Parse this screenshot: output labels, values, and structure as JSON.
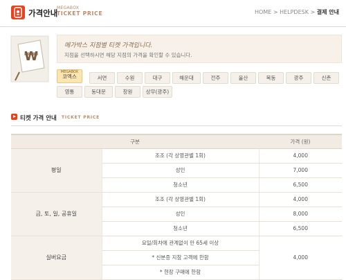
{
  "header": {
    "title": "가격안내",
    "sub_small": "MEGABOX",
    "sub_big": "TICKET PRICE",
    "breadcrumb_prefix": "HOME > HELPDESK > ",
    "breadcrumb_current": "결제 안내"
  },
  "notice": {
    "title": "메가박스 지점별 티켓 가격입니다.",
    "desc": "지점을 선택하시면 해당 지점의 가격을 확인할 수 있습니다."
  },
  "branches": {
    "row1": [
      "코엑스",
      "서면",
      "수원",
      "대구",
      "해운대",
      "전주",
      "울산",
      "목동",
      "광주",
      "신촌"
    ],
    "row2": [
      "영통",
      "동대문",
      "창원",
      "상무(광주)"
    ],
    "active_badge": "MEGABOX"
  },
  "section": {
    "title": "티켓 가격 안내",
    "title_en": "TICKET PRICE"
  },
  "table": {
    "headers": [
      "구분",
      "가격 (원)"
    ],
    "groups": [
      {
        "category": "평일",
        "rows": [
          {
            "kind": "조조 (각 상영관별 1회)",
            "price": "4,000"
          },
          {
            "kind": "성인",
            "price": "7,000"
          },
          {
            "kind": "청소년",
            "price": "6,500"
          }
        ]
      },
      {
        "category": "금, 토, 일, 공휴일",
        "rows": [
          {
            "kind": "조조 (각 상영관별 1회)",
            "price": "4,000"
          },
          {
            "kind": "성인",
            "price": "8,000"
          },
          {
            "kind": "청소년",
            "price": "6,500"
          }
        ]
      },
      {
        "category": "실버요금",
        "lines": [
          "요일/회차에 관계없이 만 65세 이상",
          "* 신분증 지참 고객에 한함",
          "* 현장 구매에 한함"
        ],
        "price": "4,000"
      }
    ]
  },
  "colors": {
    "accent": "#e8431f",
    "category_bg": "#f5f0ea",
    "notice_bg": "#f7f1e9"
  },
  "icons": {
    "header": "ticket-logo-icon",
    "notice": "price-tag-icon",
    "section": "arrow-bullet-icon"
  }
}
